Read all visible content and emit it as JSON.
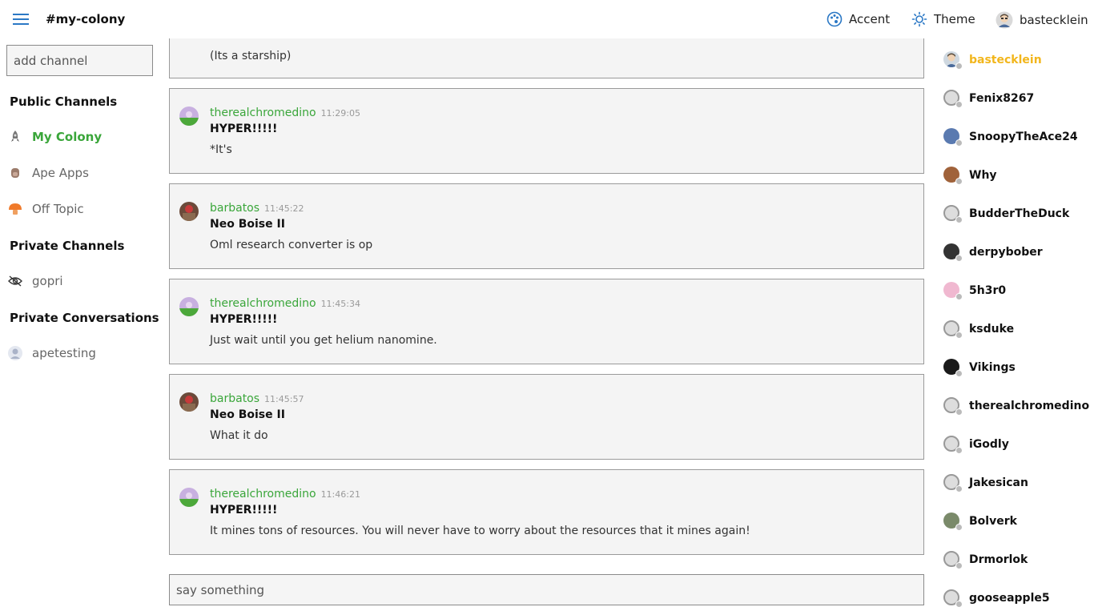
{
  "header": {
    "channel": "#my-colony",
    "accent_label": "Accent",
    "theme_label": "Theme",
    "user_label": "bastecklein"
  },
  "sidebar": {
    "add_channel_placeholder": "add channel",
    "public_heading": "Public Channels",
    "public": [
      {
        "label": "My Colony",
        "icon": "rocket-icon",
        "active": true
      },
      {
        "label": "Ape Apps",
        "icon": "ape-icon",
        "active": false
      },
      {
        "label": "Off Topic",
        "icon": "mushroom-icon",
        "active": false
      }
    ],
    "private_heading": "Private Channels",
    "private": [
      {
        "label": "gopri",
        "icon": "hidden-eye-icon"
      }
    ],
    "conversations_heading": "Private Conversations",
    "conversations": [
      {
        "label": "apetesting",
        "icon": "user-avatar-icon"
      }
    ]
  },
  "messages": [
    {
      "author": "",
      "time": "",
      "server": "",
      "text": "(Its a starship)"
    },
    {
      "author": "therealchromedino",
      "time": "11:29:05",
      "server": "HYPER!!!!!",
      "text": "*It's"
    },
    {
      "author": "barbatos",
      "time": "11:45:22",
      "server": "Neo Boise II",
      "text": "Oml research converter is op"
    },
    {
      "author": "therealchromedino",
      "time": "11:45:34",
      "server": "HYPER!!!!!",
      "text": "Just wait until you get helium nanomine."
    },
    {
      "author": "barbatos",
      "time": "11:45:57",
      "server": "Neo Boise II",
      "text": "What it do"
    },
    {
      "author": "therealchromedino",
      "time": "11:46:21",
      "server": "HYPER!!!!!",
      "text": "It mines tons of resources. You will never have to worry about the resources that it mines again!"
    }
  ],
  "composer": {
    "placeholder": "say something"
  },
  "users": [
    {
      "name": "bastecklein",
      "me": true
    },
    {
      "name": "Fenix8267"
    },
    {
      "name": "SnoopyTheAce24"
    },
    {
      "name": "Why"
    },
    {
      "name": "BudderTheDuck"
    },
    {
      "name": "derpybober"
    },
    {
      "name": "5h3r0"
    },
    {
      "name": "ksduke"
    },
    {
      "name": "Vikings"
    },
    {
      "name": "therealchromedino"
    },
    {
      "name": "iGodly"
    },
    {
      "name": "Jakesican"
    },
    {
      "name": "Bolverk"
    },
    {
      "name": "Drmorlok"
    },
    {
      "name": "gooseapple5"
    }
  ],
  "colors": {
    "accent_blue": "#2b78c5",
    "author_green": "#3aa63a",
    "self_yellow": "#f2b61c"
  }
}
